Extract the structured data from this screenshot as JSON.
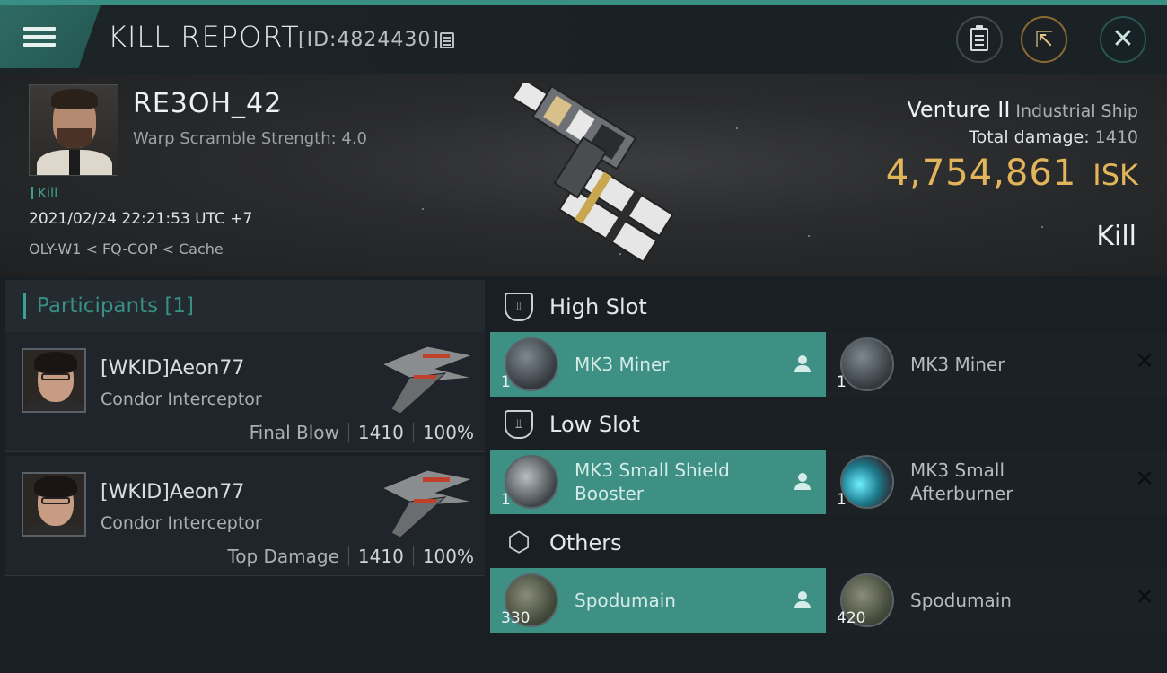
{
  "header": {
    "title": "KILL REPORT",
    "report_id": "[ID:4824430]",
    "menu_icon": "hamburger-menu-icon",
    "buttons": [
      "clipboard-icon",
      "share-icon",
      "close-icon"
    ]
  },
  "victim": {
    "name": "RE3OH_42",
    "subtitle": "Warp Scramble Strength: 4.0",
    "tag": "Kill",
    "time": "2021/02/24 22:21:53 UTC +7",
    "location": "OLY-W1 < FQ-COP < Cache",
    "ship_name": "Venture II",
    "ship_class": "Industrial Ship",
    "total_damage_label": "Total damage:",
    "total_damage": "1410",
    "isk_value": "4,754,861",
    "isk_unit": "ISK",
    "result": "Kill"
  },
  "participants": {
    "title": "Participants [1]",
    "rows": [
      {
        "name": "[WKID]Aeon77",
        "ship": "Condor Interceptor",
        "label": "Final Blow",
        "damage": "1410",
        "percent": "100%"
      },
      {
        "name": "[WKID]Aeon77",
        "ship": "Condor Interceptor",
        "label": "Top Damage",
        "damage": "1410",
        "percent": "100%"
      }
    ]
  },
  "fitting": {
    "high_slot": {
      "title": "High Slot",
      "destroyed": {
        "name": "MK3 Miner",
        "qty": "1"
      },
      "dropped": {
        "name": "MK3 Miner",
        "qty": "1"
      }
    },
    "low_slot": {
      "title": "Low Slot",
      "destroyed": {
        "name": "MK3 Small Shield Booster",
        "qty": "1"
      },
      "dropped": {
        "name": "MK3 Small Afterburner",
        "qty": "1"
      }
    },
    "others": {
      "title": "Others",
      "destroyed": {
        "name": "Spodumain",
        "qty": "330"
      },
      "dropped": {
        "name": "Spodumain",
        "qty": "420"
      }
    }
  },
  "colors": {
    "accent": "#3a8f85",
    "isk": "#e2b55a",
    "destroyed_bg": "#3e8f84"
  }
}
